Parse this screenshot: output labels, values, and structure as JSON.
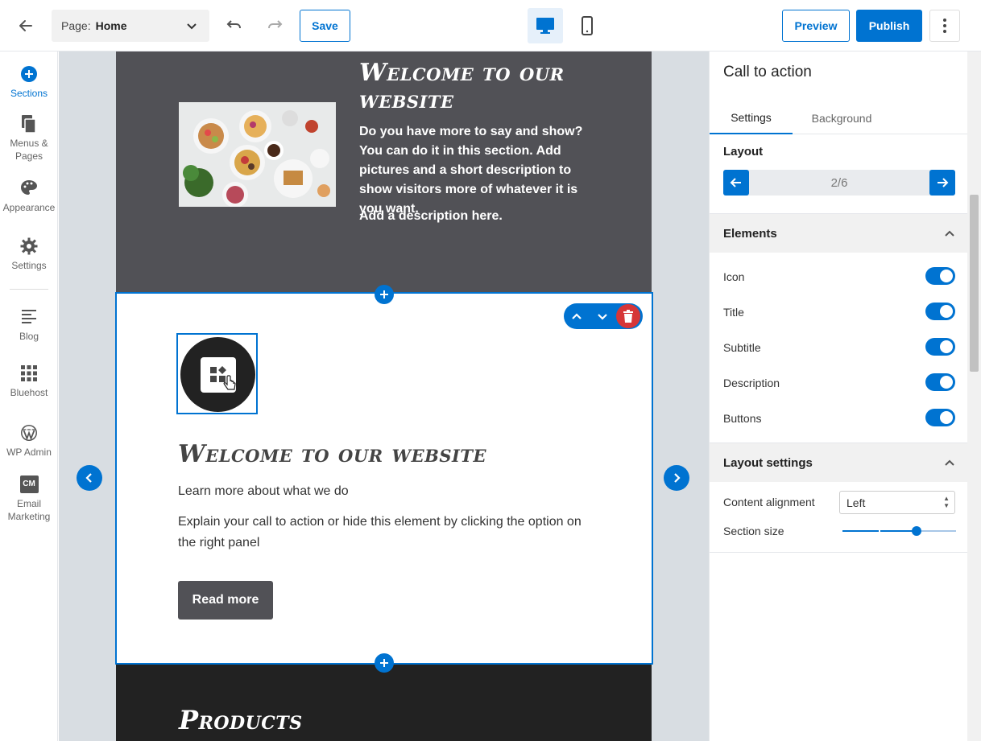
{
  "topbar": {
    "page_label": "Page:",
    "page_value": "Home",
    "save_label": "Save",
    "preview_label": "Preview",
    "publish_label": "Publish"
  },
  "sidebar": {
    "items": [
      {
        "label": "Sections",
        "icon": "plus-circle-icon",
        "active": true
      },
      {
        "label": "Menus & Pages",
        "icon": "pages-icon"
      },
      {
        "label": "Appearance",
        "icon": "palette-icon"
      },
      {
        "label": "Settings",
        "icon": "gear-icon"
      },
      {
        "label": "Blog",
        "icon": "blog-icon"
      },
      {
        "label": "Bluehost",
        "icon": "grid-icon"
      },
      {
        "label": "WP Admin",
        "icon": "wordpress-icon"
      },
      {
        "label": "Email Marketing",
        "icon": "cm-icon",
        "badge": "CM"
      }
    ]
  },
  "canvas": {
    "hero": {
      "title": "Welcome to our website",
      "body": "Do you have more to say and show? You can do it in this section. Add pictures and a short description to show visitors more of whatever it is you want.",
      "description": "Add a description here."
    },
    "cta": {
      "title": "Welcome to our website",
      "subtitle": "Learn more about what we do",
      "description": "Explain your call to action or hide this element by clicking the option on the right panel",
      "button_label": "Read more"
    },
    "products": {
      "title": "Products"
    }
  },
  "panel": {
    "title": "Call to action",
    "tabs": [
      {
        "label": "Settings",
        "active": true
      },
      {
        "label": "Background"
      }
    ],
    "layout": {
      "label": "Layout",
      "value": "2/6"
    },
    "elements": {
      "heading": "Elements",
      "toggles": [
        {
          "label": "Icon",
          "on": true
        },
        {
          "label": "Title",
          "on": true
        },
        {
          "label": "Subtitle",
          "on": true
        },
        {
          "label": "Description",
          "on": true
        },
        {
          "label": "Buttons",
          "on": true
        }
      ]
    },
    "layout_settings": {
      "heading": "Layout settings",
      "content_alignment_label": "Content alignment",
      "content_alignment_value": "Left",
      "section_size_label": "Section size",
      "section_size_fraction": 0.65
    }
  },
  "colors": {
    "accent": "#0073d1",
    "danger": "#d63638",
    "dark_section": "#515156"
  }
}
